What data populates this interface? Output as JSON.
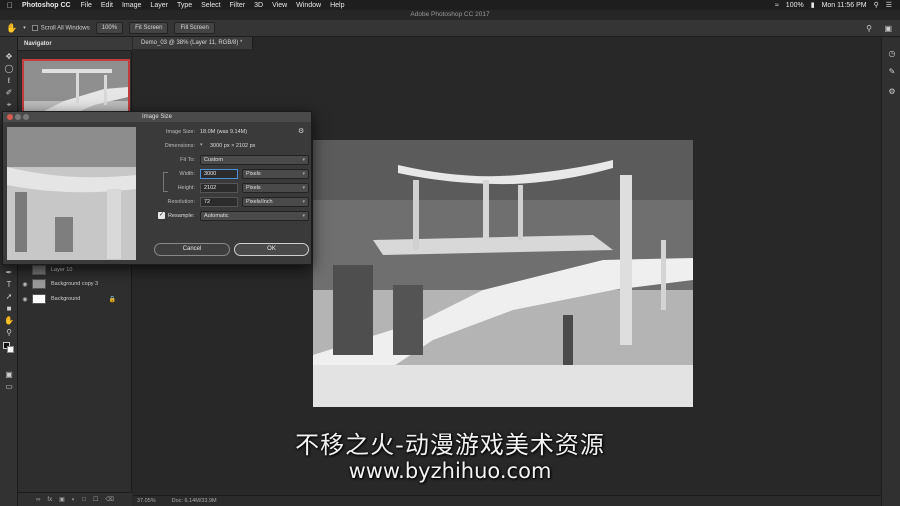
{
  "menubar": {
    "app": "Photoshop CC",
    "items": [
      "File",
      "Edit",
      "Image",
      "Layer",
      "Type",
      "Select",
      "Filter",
      "3D",
      "View",
      "Window",
      "Help"
    ],
    "battery": "100%",
    "clock": "Mon 11:56 PM"
  },
  "window_title": "Adobe Photoshop CC 2017",
  "options": {
    "scroll_all": "Scroll All Windows",
    "zoom": "100%",
    "fit_screen": "Fit Screen",
    "fill_screen": "Fill Screen"
  },
  "document": {
    "tab": "Demo_03 @ 38% (Layer 11, RGB/8) *",
    "zoom_status": "37.05%",
    "doc_status": "Doc: 6.14M/33.9M"
  },
  "panels": {
    "navigator": "Navigator",
    "layers": [
      {
        "name": "Layer 10"
      },
      {
        "name": "Background copy 3"
      },
      {
        "name": "Background"
      }
    ]
  },
  "dialog": {
    "title": "Image Size",
    "image_size_label": "Image Size:",
    "image_size_value": "18.0M (was 9.14M)",
    "dimensions_label": "Dimensions:",
    "dimensions_value": "3000 px  ×  2102 px",
    "fit_to_label": "Fit To:",
    "fit_to_value": "Custom",
    "width_label": "Width:",
    "width_value": "3000",
    "width_unit": "Pixels",
    "height_label": "Height:",
    "height_value": "2102",
    "height_unit": "Pixels",
    "resolution_label": "Resolution:",
    "resolution_value": "72",
    "resolution_unit": "Pixels/Inch",
    "resample_label": "Resample:",
    "resample_value": "Automatic",
    "cancel": "Cancel",
    "ok": "OK"
  },
  "watermark": {
    "line1": "不移之火-动漫游戏美术资源",
    "line2": "www.byzhihuo.com"
  }
}
